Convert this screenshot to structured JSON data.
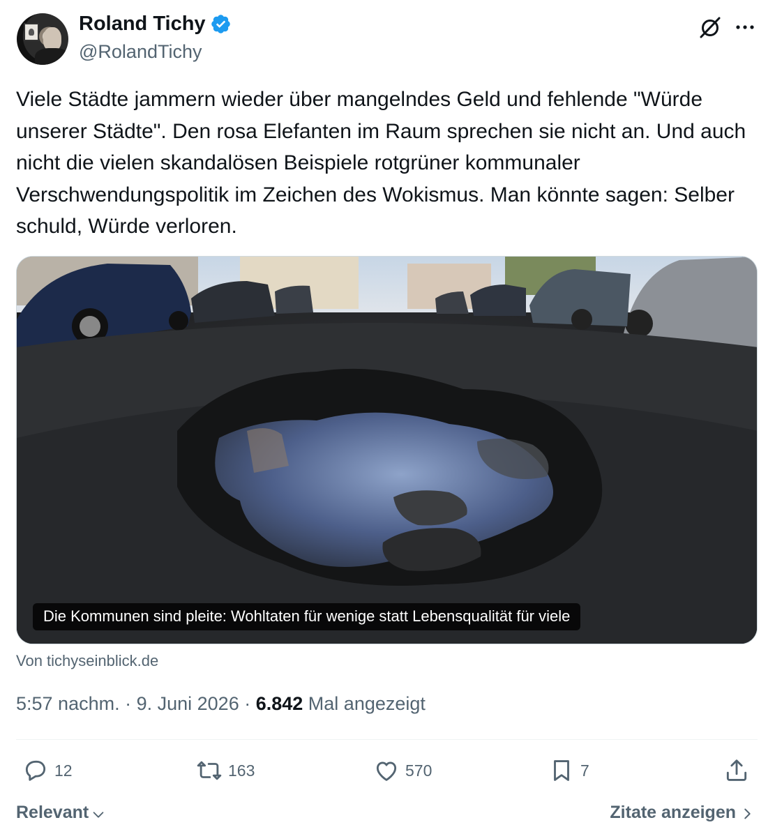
{
  "author": {
    "display_name": "Roland Tichy",
    "handle": "@RolandTichy",
    "verified": true,
    "verified_color": "#1d9bf0"
  },
  "post": {
    "text": "Viele Städte jammern wieder über mangelndes Geld und fehlende \"Würde unserer Städte\". Den rosa Elefanten im Raum sprechen sie nicht an. Und auch nicht die vielen skandalösen Beispiele rotgrüner kommunaler Verschwendungspolitik im Zeichen des Wokismus. Man könnte sagen: Selber schuld, Würde verloren."
  },
  "link_card": {
    "caption": "Die Kommunen sind pleite: Wohltaten für wenige statt Lebensqualität für viele",
    "source": "Von tichyseinblick.de"
  },
  "meta": {
    "time": "5:57 nachm.",
    "separator": " · ",
    "date": "9. Juni 2026",
    "views_count": "6.842",
    "views_label": " Mal angezeigt"
  },
  "actions": {
    "replies": "12",
    "reposts": "163",
    "likes": "570",
    "bookmarks": "7"
  },
  "footer": {
    "sort_label": "Relevant",
    "quotes_label": "Zitate anzeigen"
  },
  "icons": {
    "header_right": [
      "grok-icon",
      "more-icon"
    ],
    "actions": [
      "reply-icon",
      "repost-icon",
      "like-icon",
      "bookmark-icon",
      "share-icon"
    ]
  },
  "colors": {
    "text_primary": "#0f1419",
    "text_secondary": "#536471",
    "divider": "#eff3f4"
  }
}
